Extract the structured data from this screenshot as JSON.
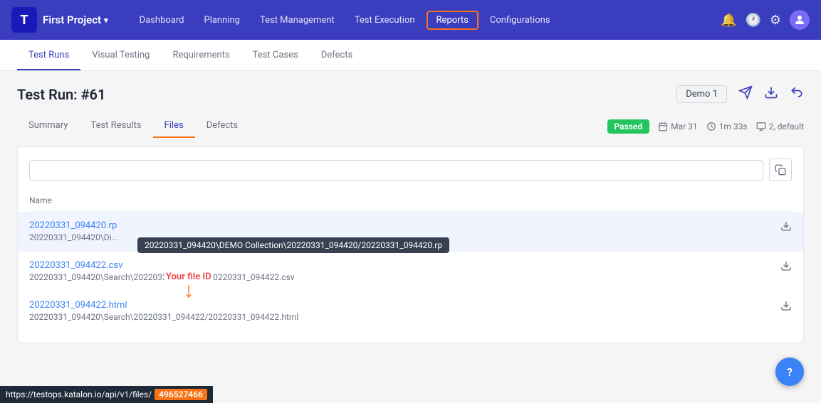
{
  "app": {
    "logo_letter": "T",
    "project_name": "First Project"
  },
  "nav": {
    "links": [
      {
        "label": "Dashboard",
        "active": false
      },
      {
        "label": "Planning",
        "active": false
      },
      {
        "label": "Test Management",
        "active": false
      },
      {
        "label": "Test Execution",
        "active": false
      },
      {
        "label": "Reports",
        "active": true
      },
      {
        "label": "Configurations",
        "active": false
      }
    ],
    "icons": {
      "bell": "🔔",
      "history": "🕐",
      "settings": "⚙"
    }
  },
  "sub_tabs": [
    {
      "label": "Test Runs",
      "active": true
    },
    {
      "label": "Visual Testing",
      "active": false
    },
    {
      "label": "Requirements",
      "active": false
    },
    {
      "label": "Test Cases",
      "active": false
    },
    {
      "label": "Defects",
      "active": false
    }
  ],
  "page": {
    "title": "Test Run: #61",
    "demo_label": "Demo 1"
  },
  "inner_tabs": [
    {
      "label": "Summary",
      "active": false
    },
    {
      "label": "Test Results",
      "active": false
    },
    {
      "label": "Files",
      "active": true
    },
    {
      "label": "Defects",
      "active": false
    }
  ],
  "status": {
    "badge": "Passed",
    "date": "Mar 31",
    "duration": "1m 33s",
    "config": "2, default"
  },
  "search_placeholder": "",
  "col_header": "Name",
  "files": [
    {
      "name": "20220331_094420.rp",
      "path": "20220331_094420\\Di...",
      "tooltip": "20220331_094420\\DEMO Collection\\20220331_094420/20220331_094420.rp",
      "highlighted": true
    },
    {
      "name": "20220331_094422.csv",
      "path": "20220331_094420\\Search\\20220331_094422/20220331_094422.csv",
      "tooltip": null,
      "highlighted": false
    },
    {
      "name": "20220331_094422.html",
      "path": "20220331_094420\\Search\\20220331_094422/20220331_094422.html",
      "tooltip": null,
      "highlighted": false,
      "has_annotation": true,
      "annotation_label": "Your file ID"
    }
  ],
  "bottom_bar": {
    "prefix": "https://testops.katalon.io/api/v1/files/",
    "file_id": "496527466"
  },
  "fab_label": "?"
}
